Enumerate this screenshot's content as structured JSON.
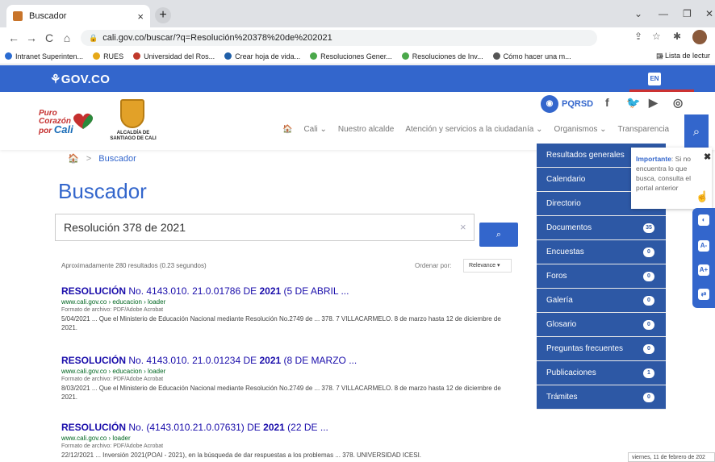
{
  "browser": {
    "tab_title": "Buscador",
    "tab_close": "×",
    "new_tab": "+",
    "back": "←",
    "forward": "→",
    "reload": "C",
    "home": "⌂",
    "url": "cali.gov.co/buscar/?q=Resolución%20378%20de%202021",
    "minimize": "—",
    "restore": "❐",
    "close": "✕",
    "bookmarks_more": "»",
    "bookmarks": [
      {
        "label": "Intranet Superinten...",
        "color": "#2a6bd1"
      },
      {
        "label": "RUES",
        "color": "#e6a817"
      },
      {
        "label": "Universidad del Ros...",
        "color": "#c0392b"
      },
      {
        "label": "Crear hoja de vida...",
        "color": "#1f5fa8"
      },
      {
        "label": "Resoluciones Gener...",
        "color": "#4aa84a"
      },
      {
        "label": "Resoluciones de Inv...",
        "color": "#4aa84a"
      },
      {
        "label": "Cómo hacer una m...",
        "color": "#555555"
      }
    ],
    "reading_list": "Lista de lectur"
  },
  "govbar": {
    "logo": "GOV.CO",
    "lang": "EN"
  },
  "header": {
    "logo_line1": "Puro",
    "logo_line2": "Corazón",
    "logo_line3": "por",
    "logo_line4": "Cali",
    "alcaldia": "ALCALDÍA DE SANTIAGO DE CALI",
    "pqrsd": "PQRSD",
    "menu": [
      "Cali ⌄",
      "Nuestro alcalde",
      "Atención y servicios a la ciudadanía ⌄",
      "Organismos ⌄",
      "Transparencia"
    ]
  },
  "main": {
    "breadcrumb": "Buscador",
    "breadcrumb_sep": ">",
    "title": "Buscador",
    "search_value": "Resolución 378 de 2021",
    "clear": "×",
    "stats": "Aproximadamente 280 resultados (0.23 segundos)",
    "order_label": "Ordenar por:",
    "order_value": "Relevance ▾",
    "results": [
      {
        "title_pre": "RESOLUCIÓN",
        "title_mid": " No. 4143.010. 21.0.01786 DE ",
        "title_year": "2021",
        "title_post": " (5 DE ABRIL ...",
        "url": "www.cali.gov.co › educacion › loader",
        "format": "Formato de archivo: PDF/Adobe Acrobat",
        "snippet": "5/04/2021 ... Que el Ministerio de Educación Nacional mediante Resolución No.2749 de ... 378. 7 VILLACARMELO. 8 de marzo hasta 12 de diciembre de 2021."
      },
      {
        "title_pre": "RESOLUCIÓN",
        "title_mid": " No. 4143.010. 21.0.01234 DE ",
        "title_year": "2021",
        "title_post": " (8 DE MARZO ...",
        "url": "www.cali.gov.co › educacion › loader",
        "format": "Formato de archivo: PDF/Adobe Acrobat",
        "snippet": "8/03/2021 ... Que el Ministerio de Educación Nacional mediante Resolución No.2749 de ... 378. 7 VILLACARMELO. 8 de marzo hasta 12 de diciembre de 2021."
      },
      {
        "title_pre": "RESOLUCIÓN",
        "title_mid": " No. (4143.010.21.0.07631) DE ",
        "title_year": "2021",
        "title_post": " (22 DE ...",
        "url": "www.cali.gov.co › loader",
        "format": "Formato de archivo: PDF/Adobe Acrobat",
        "snippet": "22/12/2021 ... Inversión 2021(POAI - 2021), en la búsqueda de dar respuestas a los problemas ... 378. UNIVERSIDAD ICESI."
      }
    ]
  },
  "sidemenu": [
    {
      "label": "Resultados generales",
      "count": ""
    },
    {
      "label": "Calendario",
      "count": ""
    },
    {
      "label": "Directorio",
      "count": ""
    },
    {
      "label": "Documentos",
      "count": "35"
    },
    {
      "label": "Encuestas",
      "count": "0"
    },
    {
      "label": "Foros",
      "count": "0"
    },
    {
      "label": "Galería",
      "count": "0"
    },
    {
      "label": "Glosario",
      "count": "0"
    },
    {
      "label": "Preguntas frecuentes",
      "count": "0"
    },
    {
      "label": "Publicaciones",
      "count": "1"
    },
    {
      "label": "Trámites",
      "count": "0"
    }
  ],
  "tooltip": {
    "strong": "Importante",
    "text": ": Si no encuentra lo que busca, consulta el portal anterior",
    "close": "✖"
  },
  "accessibility": [
    "◐",
    "A-",
    "A+",
    "⇄"
  ],
  "footer_date": "viernes, 11 de febrero de 202"
}
